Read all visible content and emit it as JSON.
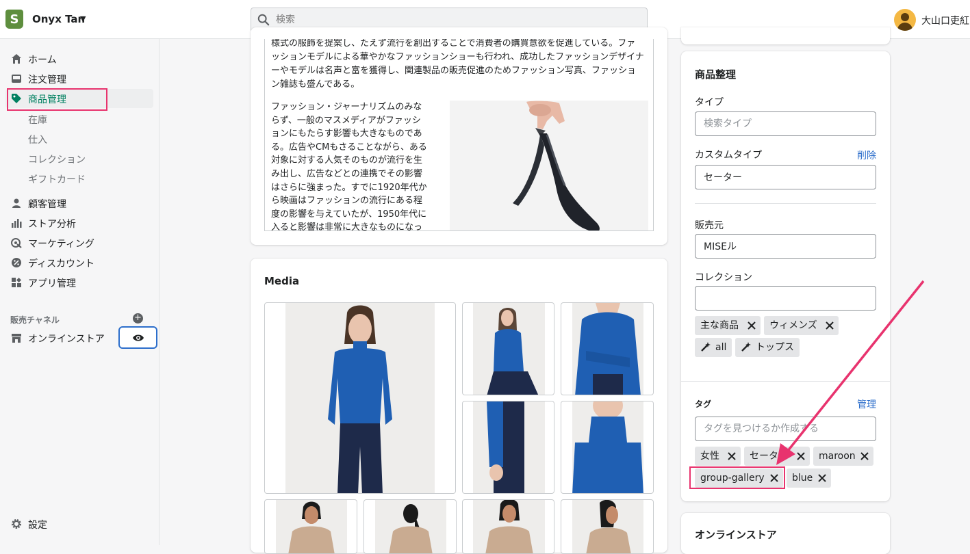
{
  "topbar": {
    "store_name": "Onyx Tan",
    "search_placeholder": "検索",
    "user_name": "大山口吏紅",
    "logo_letter": "S"
  },
  "sidebar": {
    "items": [
      {
        "label": "ホーム",
        "icon": "home-icon"
      },
      {
        "label": "注文管理",
        "icon": "inbox-icon"
      },
      {
        "label": "商品管理",
        "icon": "tag-icon",
        "active": true
      },
      {
        "label": "顧客管理",
        "icon": "person-icon"
      },
      {
        "label": "ストア分析",
        "icon": "bar-chart-icon"
      },
      {
        "label": "マーケティング",
        "icon": "target-icon"
      },
      {
        "label": "ディスカウント",
        "icon": "discount-icon"
      },
      {
        "label": "アプリ管理",
        "icon": "apps-icon"
      }
    ],
    "sub_items": [
      "在庫",
      "仕入",
      "コレクション",
      "ギフトカード"
    ],
    "channels_title": "販売チャネル",
    "online_store": "オンラインストア",
    "settings": "設定"
  },
  "description": {
    "paragraph1": "様式の服飾を提案し、たえず流行を創出することで消費者の購買意欲を促進している。ファッションモデルによる華やかなファッションショーも行われ、成功したファッションデザイナーやモデルは名声と富を獲得し、関連製品の販売促進のためファッション写真、ファッション雑誌も盛んである。",
    "paragraph2": "ファッション・ジャーナリズムのみならず、一般のマスメディアがファッションにもたらす影響も大きなものである。広告やCMもさることながら、ある対象に対する人気そのものが流行を生み出し、広告などとの連携でその影響はさらに強まった。すでに1920年代から映画はファッションの流行にある程度の影響を与えていたが、1950年代に入ると影響は非常に大きなものになっ"
  },
  "media": {
    "title": "Media"
  },
  "organization": {
    "title": "商品整理",
    "type_label": "タイプ",
    "type_placeholder": "検索タイプ",
    "custom_type_label": "カスタムタイプ",
    "delete_link": "削除",
    "custom_type_value": "セーター",
    "vendor_label": "販売元",
    "vendor_value": "MISEル",
    "collections_label": "コレクション",
    "collections_value": "",
    "collections": [
      "主な商品",
      "ウィメンズ"
    ],
    "auto_collections": [
      "all",
      "トップス"
    ]
  },
  "tags": {
    "label": "タグ",
    "manage_link": "管理",
    "placeholder": "タグを見つけるか作成する",
    "row1": [
      "女性",
      "セーター",
      "maroon"
    ],
    "row2": [
      "group-gallery",
      "blue"
    ]
  },
  "online_store_card": {
    "title": "オンラインストア"
  },
  "colors": {
    "accent_green": "#008060",
    "highlight_pink": "#e8336e",
    "link_blue": "#2c6ecb",
    "sweater_blue": "#1f5fb3",
    "pants_navy": "#1e2a4a"
  }
}
